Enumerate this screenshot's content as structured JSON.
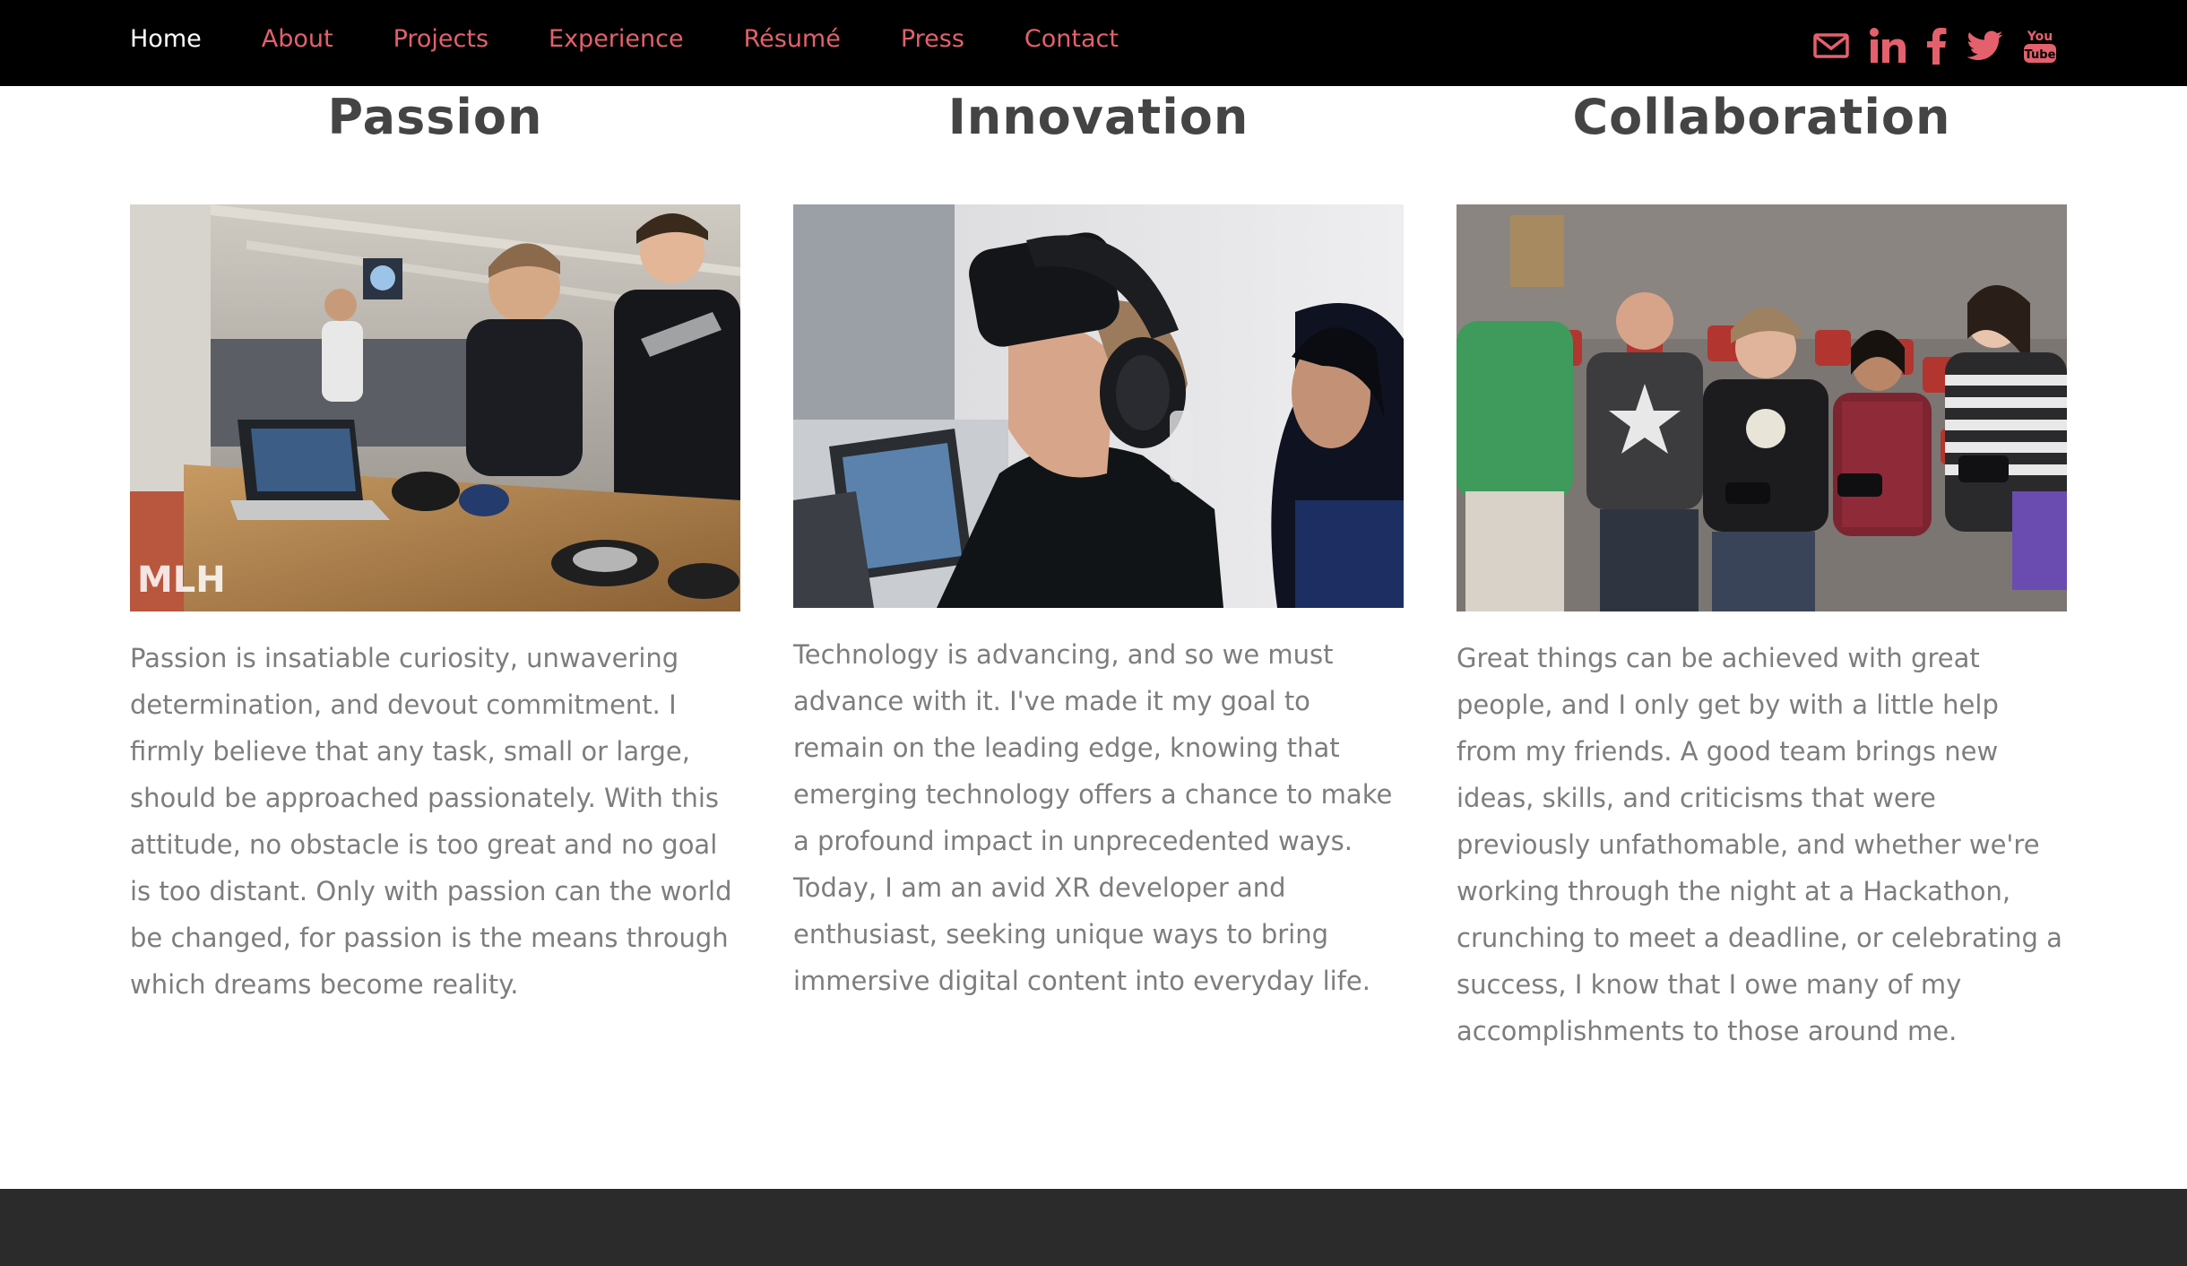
{
  "nav": {
    "items": [
      {
        "label": "Home",
        "active": true
      },
      {
        "label": "About",
        "active": false
      },
      {
        "label": "Projects",
        "active": false
      },
      {
        "label": "Experience",
        "active": false
      },
      {
        "label": "Résumé",
        "active": false
      },
      {
        "label": "Press",
        "active": false
      },
      {
        "label": "Contact",
        "active": false
      }
    ]
  },
  "social": {
    "icons": [
      "mail-icon",
      "linkedin-icon",
      "facebook-icon",
      "twitter-icon",
      "youtube-icon"
    ],
    "youtube_text_top": "You",
    "youtube_text_bottom": "Tube"
  },
  "columns": [
    {
      "title": "Passion",
      "photo_watermark": "MLH",
      "text": "Passion is insatiable curiosity, unwavering determination, and devout commitment. I firmly believe that any task, small or large, should be approached passionately. With this attitude, no obstacle is too great and no goal is too distant. Only with passion can the world be changed, for passion is the means through which dreams become reality."
    },
    {
      "title": "Innovation",
      "text": "Technology is advancing, and so we must advance with it. I've made it my goal to remain on the leading edge, knowing that emerging technology offers a chance to make a profound impact in unprecedented ways. Today, I am an avid XR developer and enthusiast, seeking unique ways to bring immersive digital content into everyday life."
    },
    {
      "title": "Collaboration",
      "text": "Great things can be achieved with great people, and I only get by with a little help from my friends. A good team brings new ideas, skills, and criticisms that were previously unfathomable, and whether we're working through the night at a Hackathon, crunching to meet a deadline, or celebrating a success, I know that I owe many of my accomplishments to those around me."
    }
  ],
  "colors": {
    "nav_bg": "#000000",
    "accent": "#e4606d",
    "heading": "#444444",
    "body_text": "#7d7d7d",
    "footer": "#2b2b2b"
  }
}
